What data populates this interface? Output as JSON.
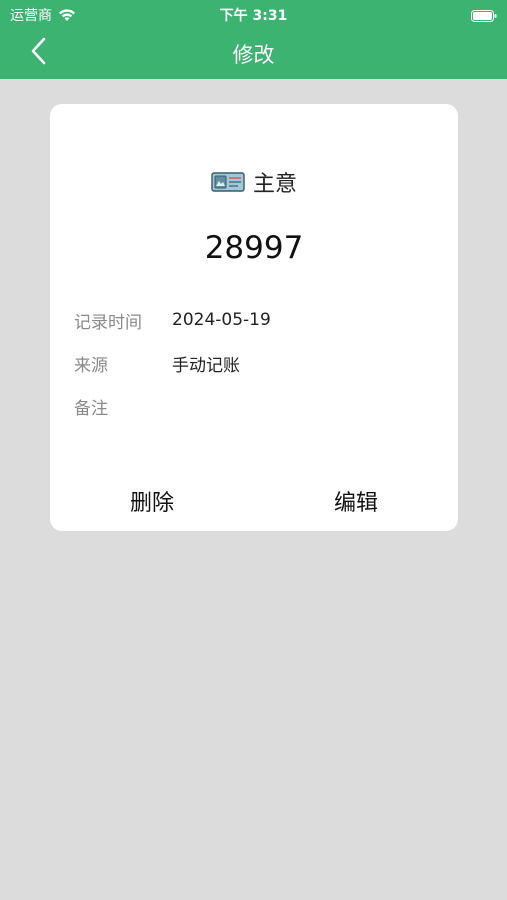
{
  "status_bar": {
    "carrier": "运营商",
    "time": "下午 3:31",
    "icons": [
      "wifi-icon",
      "battery-icon"
    ]
  },
  "nav": {
    "title": "修改",
    "back_icon": "chevron-left-icon"
  },
  "record": {
    "category_icon": "ticket-icon",
    "category": "主意",
    "amount": "28997",
    "fields": {
      "date_label": "记录时间",
      "date_value": "2024-05-19",
      "source_label": "来源",
      "source_value": "手动记账",
      "note_label": "备注",
      "note_value": ""
    },
    "actions": {
      "delete_label": "删除",
      "edit_label": "编辑"
    }
  },
  "colors": {
    "header": "#3cb371",
    "background": "#dcdcdc",
    "card": "#ffffff"
  }
}
